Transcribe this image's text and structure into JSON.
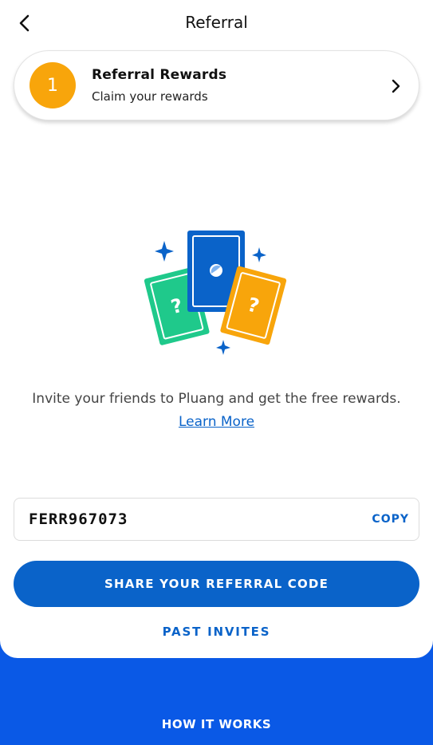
{
  "header": {
    "title": "Referral",
    "back_icon": "chevron-left-icon"
  },
  "reward_card": {
    "badge": "1",
    "title": "Referral Rewards",
    "subtitle": "Claim your rewards",
    "chevron_icon": "chevron-right-icon"
  },
  "illustration": {
    "cards": [
      "green-question-card",
      "blue-center-card",
      "orange-question-card"
    ],
    "sparkles": "sparkle-icon"
  },
  "invite": {
    "text": "Invite your friends to Pluang and get the free rewards.",
    "link": "Learn More"
  },
  "referral_code": {
    "value": "FERR967073",
    "copy_label": "COPY"
  },
  "actions": {
    "share_label": "SHARE YOUR REFERRAL CODE",
    "past_invites_label": "PAST INVITES"
  },
  "footer": {
    "how_it_works_label": "HOW IT WORKS"
  },
  "colors": {
    "brand_blue": "#0a63c9",
    "footer_blue": "#0a59e6",
    "badge_orange": "#f8a50b",
    "card_green": "#1fc98b",
    "card_orange": "#f8a50b"
  }
}
